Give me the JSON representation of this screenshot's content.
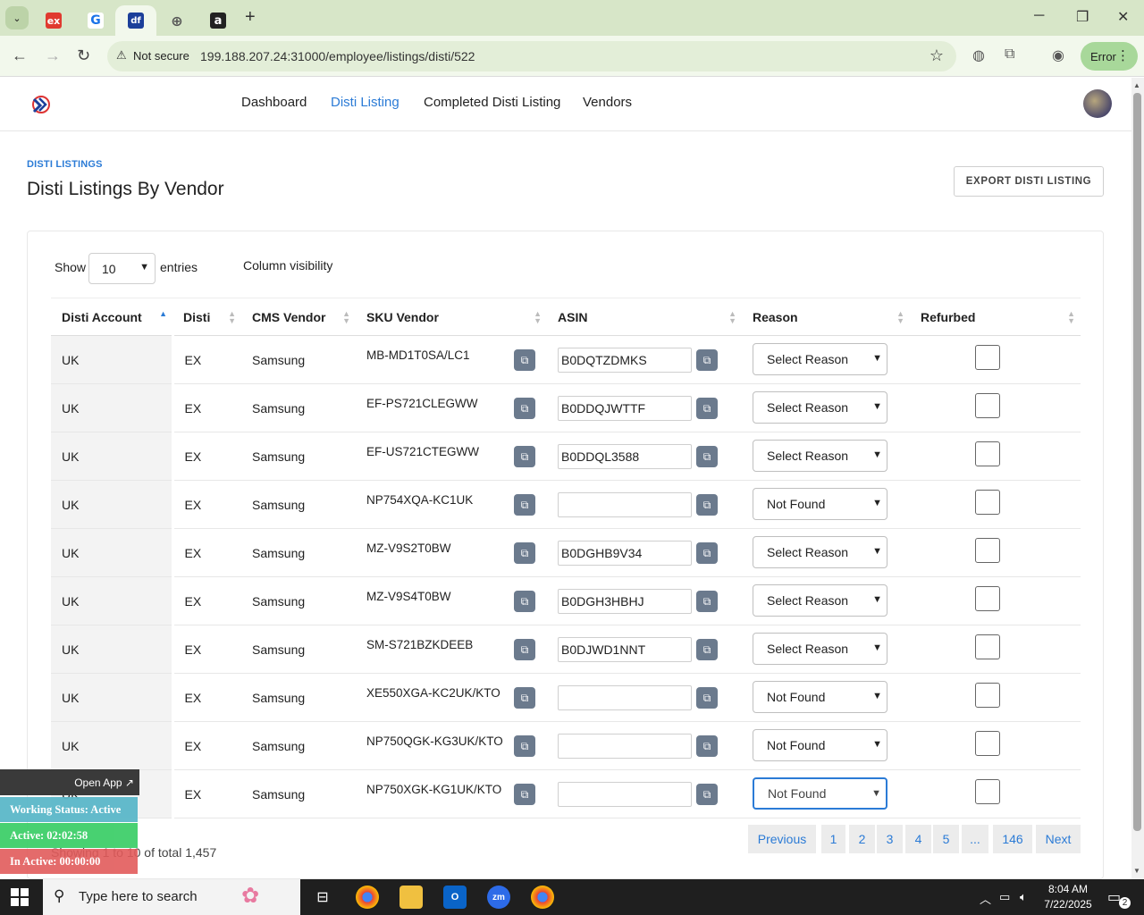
{
  "browser": {
    "tabs": [
      {
        "icon": "ex-favicon",
        "label": "ex"
      },
      {
        "icon": "g-favicon",
        "label": "G"
      },
      {
        "icon": "df-favicon",
        "label": "df"
      },
      {
        "icon": "globe-favicon",
        "label": "⊕"
      },
      {
        "icon": "amazon-favicon",
        "label": "a"
      }
    ],
    "security_label": "Not secure",
    "url": "199.188.207.24:31000/employee/listings/disti/522",
    "profile_status": "Error"
  },
  "app": {
    "nav": [
      "Dashboard",
      "Disti Listing",
      "Completed Disti Listing",
      "Vendors"
    ],
    "active_nav": "Disti Listing"
  },
  "page": {
    "breadcrumb": "DISTI LISTINGS",
    "title": "Disti Listings By Vendor",
    "export_label": "EXPORT DISTI LISTING",
    "show_label": "Show",
    "entries_value": "10",
    "entries_label": "entries",
    "column_visibility": "Column visibility"
  },
  "table": {
    "columns": [
      "Disti Account",
      "Disti",
      "CMS Vendor",
      "SKU Vendor",
      "ASIN",
      "Reason",
      "Refurbed"
    ],
    "rows": [
      {
        "account": "UK",
        "disti": "EX",
        "vendor": "Samsung",
        "sku": "MB-MD1T0SA/LC1",
        "asin": "B0DQTZDMKS",
        "reason": "Select Reason"
      },
      {
        "account": "UK",
        "disti": "EX",
        "vendor": "Samsung",
        "sku": "EF-PS721CLEGWW",
        "asin": "B0DDQJWTTF",
        "reason": "Select Reason"
      },
      {
        "account": "UK",
        "disti": "EX",
        "vendor": "Samsung",
        "sku": "EF-US721CTEGWW",
        "asin": "B0DDQL3588",
        "reason": "Select Reason"
      },
      {
        "account": "UK",
        "disti": "EX",
        "vendor": "Samsung",
        "sku": "NP754XQA-KC1UK",
        "asin": "",
        "reason": "Not Found"
      },
      {
        "account": "UK",
        "disti": "EX",
        "vendor": "Samsung",
        "sku": "MZ-V9S2T0BW",
        "asin": "B0DGHB9V34",
        "reason": "Select Reason"
      },
      {
        "account": "UK",
        "disti": "EX",
        "vendor": "Samsung",
        "sku": "MZ-V9S4T0BW",
        "asin": "B0DGH3HBHJ",
        "reason": "Select Reason"
      },
      {
        "account": "UK",
        "disti": "EX",
        "vendor": "Samsung",
        "sku": "SM-S721BZKDEEB",
        "asin": "B0DJWD1NNT",
        "reason": "Select Reason"
      },
      {
        "account": "UK",
        "disti": "EX",
        "vendor": "Samsung",
        "sku": "XE550XGA-KC2UK/KTO",
        "asin": "",
        "reason": "Not Found"
      },
      {
        "account": "UK",
        "disti": "EX",
        "vendor": "Samsung",
        "sku": "NP750QGK-KG3UK/KTO",
        "asin": "",
        "reason": "Not Found"
      },
      {
        "account": "UK",
        "disti": "EX",
        "vendor": "Samsung",
        "sku": "NP750XGK-KG1UK/KTO",
        "asin": "",
        "reason": "Not Found"
      }
    ]
  },
  "footer": {
    "showing": "Showing 1 to 10 of total 1,457",
    "pagination": [
      "Previous",
      "1",
      "2",
      "3",
      "4",
      "5",
      "...",
      "146",
      "Next"
    ]
  },
  "overlay": {
    "open_app": "Open App ↗",
    "working_status": "Working Status: Active",
    "active_time": "Active: 02:02:58",
    "inactive_time": "In Active: 00:00:00",
    "colors": {
      "working": "#5bb8c9",
      "active": "#3fcf6a",
      "inactive": "#e25b5b"
    }
  },
  "taskbar": {
    "search_placeholder": "Type here to search",
    "time": "8:04 AM",
    "date": "7/22/2025",
    "notification_count": "2"
  },
  "colors": {
    "accent": "#2b7bd6",
    "tab_strip": "#d7e6c8",
    "copy_button": "#6b7a8d"
  }
}
